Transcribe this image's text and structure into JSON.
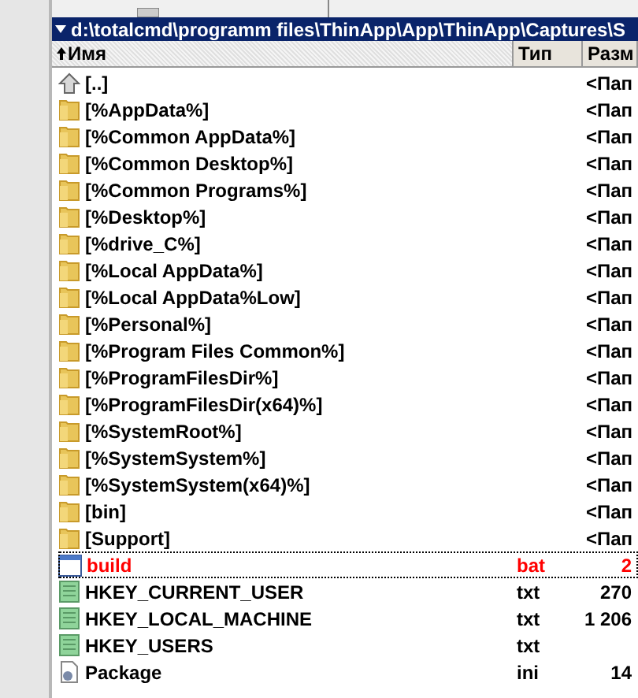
{
  "path": "d:\\totalcmd\\programm files\\ThinApp\\App\\ThinApp\\Captures\\S",
  "columns": [
    {
      "label": "Имя",
      "sorted": true
    },
    {
      "label": "Тип",
      "sorted": false
    },
    {
      "label": "Разм",
      "sorted": false
    }
  ],
  "rows": [
    {
      "kind": "up",
      "name": "[..]",
      "size": "<Пап",
      "selected": false
    },
    {
      "kind": "folder",
      "name": "[%AppData%]",
      "size": "<Пап",
      "selected": false
    },
    {
      "kind": "folder",
      "name": "[%Common AppData%]",
      "size": "<Пап",
      "selected": false
    },
    {
      "kind": "folder",
      "name": "[%Common Desktop%]",
      "size": "<Пап",
      "selected": false
    },
    {
      "kind": "folder",
      "name": "[%Common Programs%]",
      "size": "<Пап",
      "selected": false
    },
    {
      "kind": "folder",
      "name": "[%Desktop%]",
      "size": "<Пап",
      "selected": false
    },
    {
      "kind": "folder",
      "name": "[%drive_C%]",
      "size": "<Пап",
      "selected": false
    },
    {
      "kind": "folder",
      "name": "[%Local AppData%]",
      "size": "<Пап",
      "selected": false
    },
    {
      "kind": "folder",
      "name": "[%Local AppData%Low]",
      "size": "<Пап",
      "selected": false
    },
    {
      "kind": "folder",
      "name": "[%Personal%]",
      "size": "<Пап",
      "selected": false
    },
    {
      "kind": "folder",
      "name": "[%Program Files Common%]",
      "size": "<Пап",
      "selected": false
    },
    {
      "kind": "folder",
      "name": "[%ProgramFilesDir%]",
      "size": "<Пап",
      "selected": false
    },
    {
      "kind": "folder",
      "name": "[%ProgramFilesDir(x64)%]",
      "size": "<Пап",
      "selected": false
    },
    {
      "kind": "folder",
      "name": "[%SystemRoot%]",
      "size": "<Пап",
      "selected": false
    },
    {
      "kind": "folder",
      "name": "[%SystemSystem%]",
      "size": "<Пап",
      "selected": false
    },
    {
      "kind": "folder",
      "name": "[%SystemSystem(x64)%]",
      "size": "<Пап",
      "selected": false
    },
    {
      "kind": "folder",
      "name": "[bin]",
      "size": "<Пап",
      "selected": false
    },
    {
      "kind": "folder",
      "name": "[Support]",
      "size": "<Пап",
      "selected": false
    },
    {
      "kind": "bat",
      "name": "build",
      "type": "bat",
      "size": "2",
      "selected": true
    },
    {
      "kind": "txt",
      "name": "HKEY_CURRENT_USER",
      "type": "txt",
      "size": "270",
      "selected": false
    },
    {
      "kind": "txt",
      "name": "HKEY_LOCAL_MACHINE",
      "type": "txt",
      "size": "1 206",
      "selected": false
    },
    {
      "kind": "txt",
      "name": "HKEY_USERS",
      "type": "txt",
      "selected": false
    },
    {
      "kind": "ini",
      "name": "Package",
      "type": "ini",
      "size": "14",
      "selected": false
    }
  ]
}
